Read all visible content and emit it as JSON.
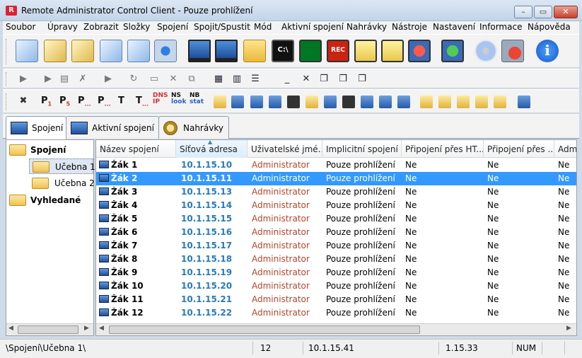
{
  "window": {
    "title": "Remote Administrator Control Client - Pouze prohlížení",
    "min": "–",
    "max": "▭",
    "close": "✕"
  },
  "menu": [
    "Soubor",
    "Úpravy",
    "Zobrazit",
    "Složky",
    "Spojení",
    "Spojit/Spustit",
    "Mód",
    "Aktivní spojení",
    "Nahrávky",
    "Nástroje",
    "Nastavení",
    "Informace",
    "Nápověda"
  ],
  "toolbar1": {
    "icons": [
      "address-book-icon",
      "scroll-icon",
      "find-icon",
      "scan-icon",
      "document-icon",
      "settings-icon",
      "full-control-icon",
      "view-only-icon",
      "file-transfer-icon",
      "telnet-icon",
      "chart-icon",
      "record-icon",
      "message-icon",
      "chat-icon",
      "shutdown-icon",
      "power-on-icon",
      "disc-icon",
      "disconnect-icon",
      "info-icon"
    ],
    "texts": {
      "telnet": "C:\\",
      "record": "REC",
      "info": "i"
    }
  },
  "toolbar3": {
    "labels": [
      "P",
      "P",
      "P",
      "P",
      "T",
      "T",
      "DNS",
      "NS",
      "NB"
    ],
    "subs": [
      "1",
      "5",
      "...",
      "...",
      "",
      "...",
      "IP",
      "look",
      "stat"
    ]
  },
  "tabs": [
    {
      "label": "Spojení",
      "active": true
    },
    {
      "label": "Aktivní spojení",
      "active": false
    },
    {
      "label": "Nahrávky",
      "active": false
    }
  ],
  "tree": [
    {
      "label": "Spojení",
      "bold": true
    },
    {
      "label": "Učebna 1",
      "selected": true
    },
    {
      "label": "Učebna 2"
    },
    {
      "label": "Vyhledané",
      "bold": true
    }
  ],
  "columns": [
    "Název spojení",
    "Síťová adresa",
    "Uživatelské jmé...",
    "Implicitní spojení",
    "Připojení přes HT...",
    "Připojení přes ...",
    "Adm"
  ],
  "rows": [
    {
      "name": "Žák 1",
      "ip": "10.1.15.10",
      "user": "Administrator",
      "mode": "Pouze prohlížení",
      "ht": "Ne",
      "p2": "Ne",
      "adm": "Ne"
    },
    {
      "name": "Žák 2",
      "ip": "10.1.15.11",
      "user": "Administrator",
      "mode": "Pouze prohlížení",
      "ht": "Ne",
      "p2": "Ne",
      "adm": "Ne",
      "selected": true
    },
    {
      "name": "Žák 3",
      "ip": "10.1.15.13",
      "user": "Administrator",
      "mode": "Pouze prohlížení",
      "ht": "Ne",
      "p2": "Ne",
      "adm": "Ne"
    },
    {
      "name": "Žák 4",
      "ip": "10.1.15.14",
      "user": "Administrator",
      "mode": "Pouze prohlížení",
      "ht": "Ne",
      "p2": "Ne",
      "adm": "Ne"
    },
    {
      "name": "Žák 5",
      "ip": "10.1.15.15",
      "user": "Administrator",
      "mode": "Pouze prohlížení",
      "ht": "Ne",
      "p2": "Ne",
      "adm": "Ne"
    },
    {
      "name": "Žák 6",
      "ip": "10.1.15.16",
      "user": "Administrator",
      "mode": "Pouze prohlížení",
      "ht": "Ne",
      "p2": "Ne",
      "adm": "Ne"
    },
    {
      "name": "Žák 7",
      "ip": "10.1.15.17",
      "user": "Administrator",
      "mode": "Pouze prohlížení",
      "ht": "Ne",
      "p2": "Ne",
      "adm": "Ne"
    },
    {
      "name": "Žák 8",
      "ip": "10.1.15.18",
      "user": "Administrator",
      "mode": "Pouze prohlížení",
      "ht": "Ne",
      "p2": "Ne",
      "adm": "Ne"
    },
    {
      "name": "Žák 9",
      "ip": "10.1.15.19",
      "user": "Administrator",
      "mode": "Pouze prohlížení",
      "ht": "Ne",
      "p2": "Ne",
      "adm": "Ne"
    },
    {
      "name": "Žák 10",
      "ip": "10.1.15.20",
      "user": "Administrator",
      "mode": "Pouze prohlížení",
      "ht": "Ne",
      "p2": "Ne",
      "adm": "Ne"
    },
    {
      "name": "Žák 11",
      "ip": "10.1.15.21",
      "user": "Administrator",
      "mode": "Pouze prohlížení",
      "ht": "Ne",
      "p2": "Ne",
      "adm": "Ne"
    },
    {
      "name": "Žák 12",
      "ip": "10.1.15.22",
      "user": "Administrator",
      "mode": "Pouze prohlížení",
      "ht": "Ne",
      "p2": "Ne",
      "adm": "Ne"
    }
  ],
  "statusbar": {
    "path": "\\Spojení\\Učebna 1\\",
    "count": "12",
    "ip": "10.1.15.41",
    "version": "1.15.33",
    "num": "NUM"
  },
  "colors": {
    "selection": "#3399ff",
    "ip_text": "#2a7ab8",
    "user_text": "#b0462c"
  }
}
